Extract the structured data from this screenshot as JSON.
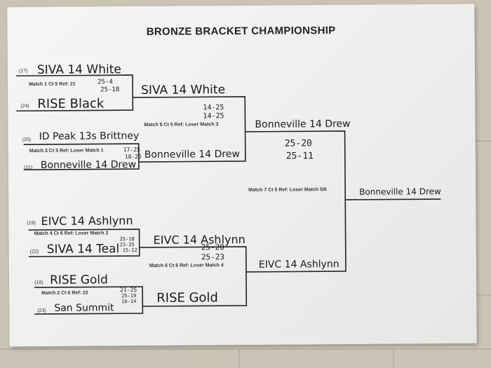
{
  "title": "BRONZE BRACKET CHAMPIONSHIP",
  "round1": [
    {
      "top_seed": "(17)",
      "top_team": "SIVA 14 White",
      "bottom_seed": "(24)",
      "bottom_team": "RISE Black",
      "info": "Match 1   Ct 5   Ref: 21",
      "score1": "25-4",
      "score2": "25-18"
    },
    {
      "top_seed": "(20)",
      "top_team": "ID Peak 13s Brittney",
      "bottom_seed": "(21)",
      "bottom_team": "Bonneville 14 Drew",
      "info": "Match 3   Ct 5   Ref: Loser Match 1",
      "score1": "17-25",
      "score2": "18-25"
    },
    {
      "top_seed": "(19)",
      "top_team": "EIVC 14 Ashlynn",
      "bottom_seed": "(22)",
      "bottom_team": "SIVA 14 Teal",
      "info": "Match 4   Ct 6   Ref: Loser Match 2",
      "score1": "25-18",
      "score2": "23-25",
      "score3": "15-12"
    },
    {
      "top_seed": "(18)",
      "top_team": "RISE Gold",
      "bottom_seed": "(23)",
      "bottom_team": "San Summit",
      "info": "Match 2   Ct 6   Ref: 22",
      "score1": "21-25",
      "score2": "25-19",
      "score3": "16-14"
    }
  ],
  "round2": [
    {
      "winner": "SIVA 14 White",
      "info": "Match 5   Ct 5   Ref: Loser Match 3",
      "score1": "14-25",
      "score2": "14-25"
    },
    {
      "winner": "Bonneville 14 Drew"
    },
    {
      "winner": "EIVC 14 Ashlynn",
      "info": "Match 6   Ct 6   Ref: Loser Match 4",
      "score1": "25-20",
      "score2": "25-23"
    },
    {
      "winner": "RISE Gold"
    }
  ],
  "round3": [
    {
      "winner": "Bonneville 14 Drew",
      "score1": "25-20",
      "score2": "25-11",
      "info": "Match 7   Ct 5   Ref: Loser Match 5/6"
    },
    {
      "winner": "EIVC 14 Ashlynn"
    }
  ],
  "champion": "Bonneville 14 Drew"
}
